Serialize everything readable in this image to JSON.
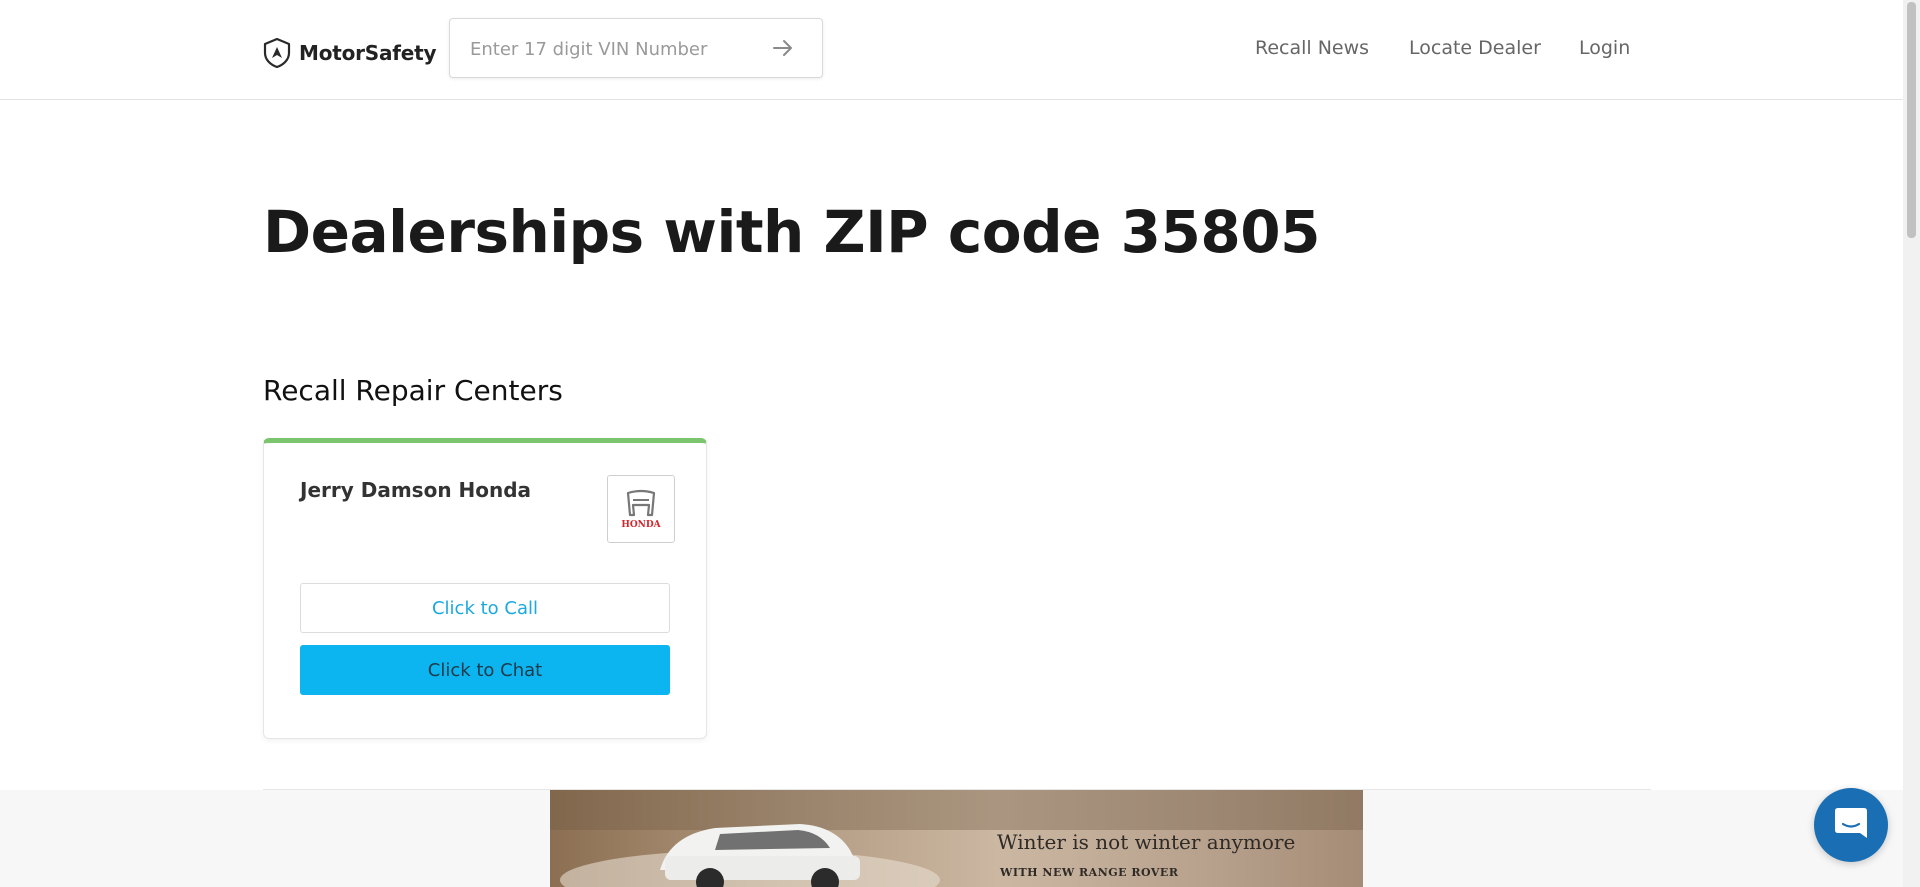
{
  "header": {
    "logo_text": "MotorSafety",
    "vin_placeholder": "Enter 17 digit VIN Number",
    "nav": [
      "Recall News",
      "Locate Dealer",
      "Login"
    ]
  },
  "main": {
    "title": "Dealerships with ZIP code 35805",
    "section_title": "Recall Repair Centers",
    "card": {
      "dealer_name": "Jerry Damson Honda",
      "brand_logo_text": "HONDA",
      "call_label": "Click to Call",
      "chat_label": "Click to Chat",
      "accent_color": "#7cc56f"
    }
  },
  "ad": {
    "headline": "Winter is not winter anymore",
    "subline": "WITH NEW RANGE ROVER"
  },
  "colors": {
    "link_blue": "#1aa9e0",
    "chat_button": "#0db5f0",
    "launcher": "#1a6fb4"
  },
  "icons": {
    "logo": "shield-icon",
    "vin_submit": "arrow-right-icon",
    "chat_launcher": "chat-bubble-icon"
  }
}
